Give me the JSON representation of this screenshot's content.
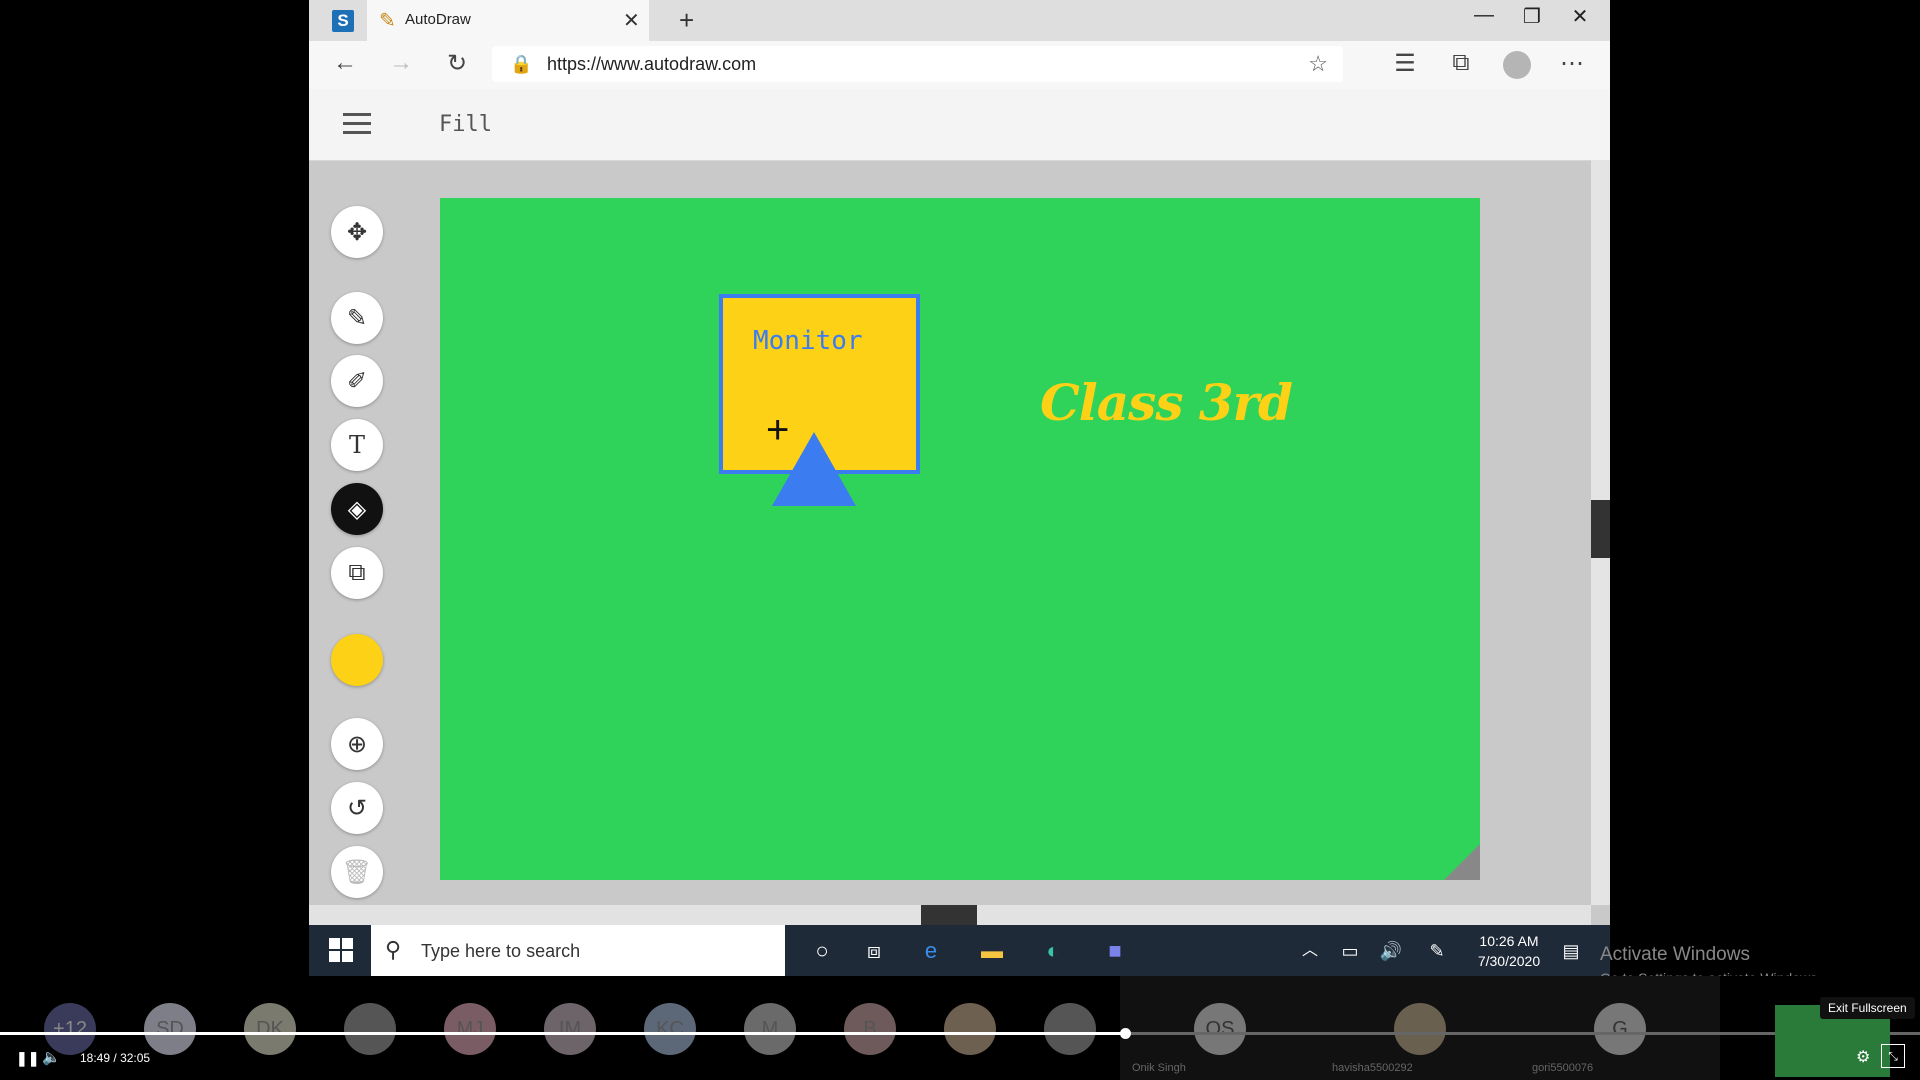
{
  "browser": {
    "tab_title": "AutoDraw",
    "tab_close": "✕",
    "new_tab": "+",
    "url": "https://www.autodraw.com",
    "window_controls": [
      "—",
      "❐",
      "✕"
    ]
  },
  "app": {
    "title": "Fill",
    "tools": [
      "move-icon",
      "autodraw-icon",
      "draw-icon",
      "text-icon",
      "fill-icon",
      "shape-icon",
      "zoom-icon",
      "undo-icon",
      "delete-icon"
    ],
    "active_tool": "fill-icon",
    "selected_color": "#fcd116"
  },
  "canvas": {
    "background": "#2fd35a",
    "monitor_label": "Monitor",
    "class_label": "Class 3rd"
  },
  "taskbar": {
    "search_placeholder": "Type here to search",
    "time": "10:26 AM",
    "date": "7/30/2020"
  },
  "watermark": {
    "title": "Activate Windows",
    "subtitle": "Go to Settings to activate Windows."
  },
  "video": {
    "elapsed": "18:49",
    "separator": "/",
    "duration": "32:05",
    "progress_fraction": 0.586,
    "exit_fullscreen": "Exit Fullscreen",
    "participants": [
      "+12",
      "SD",
      "DK",
      "",
      "MJ",
      "IM",
      "KC",
      "M",
      "B",
      "",
      "",
      "OS",
      "",
      "G"
    ],
    "participant_names": [
      "Onik Singh",
      "havisha5500292",
      "gori5500076"
    ]
  }
}
